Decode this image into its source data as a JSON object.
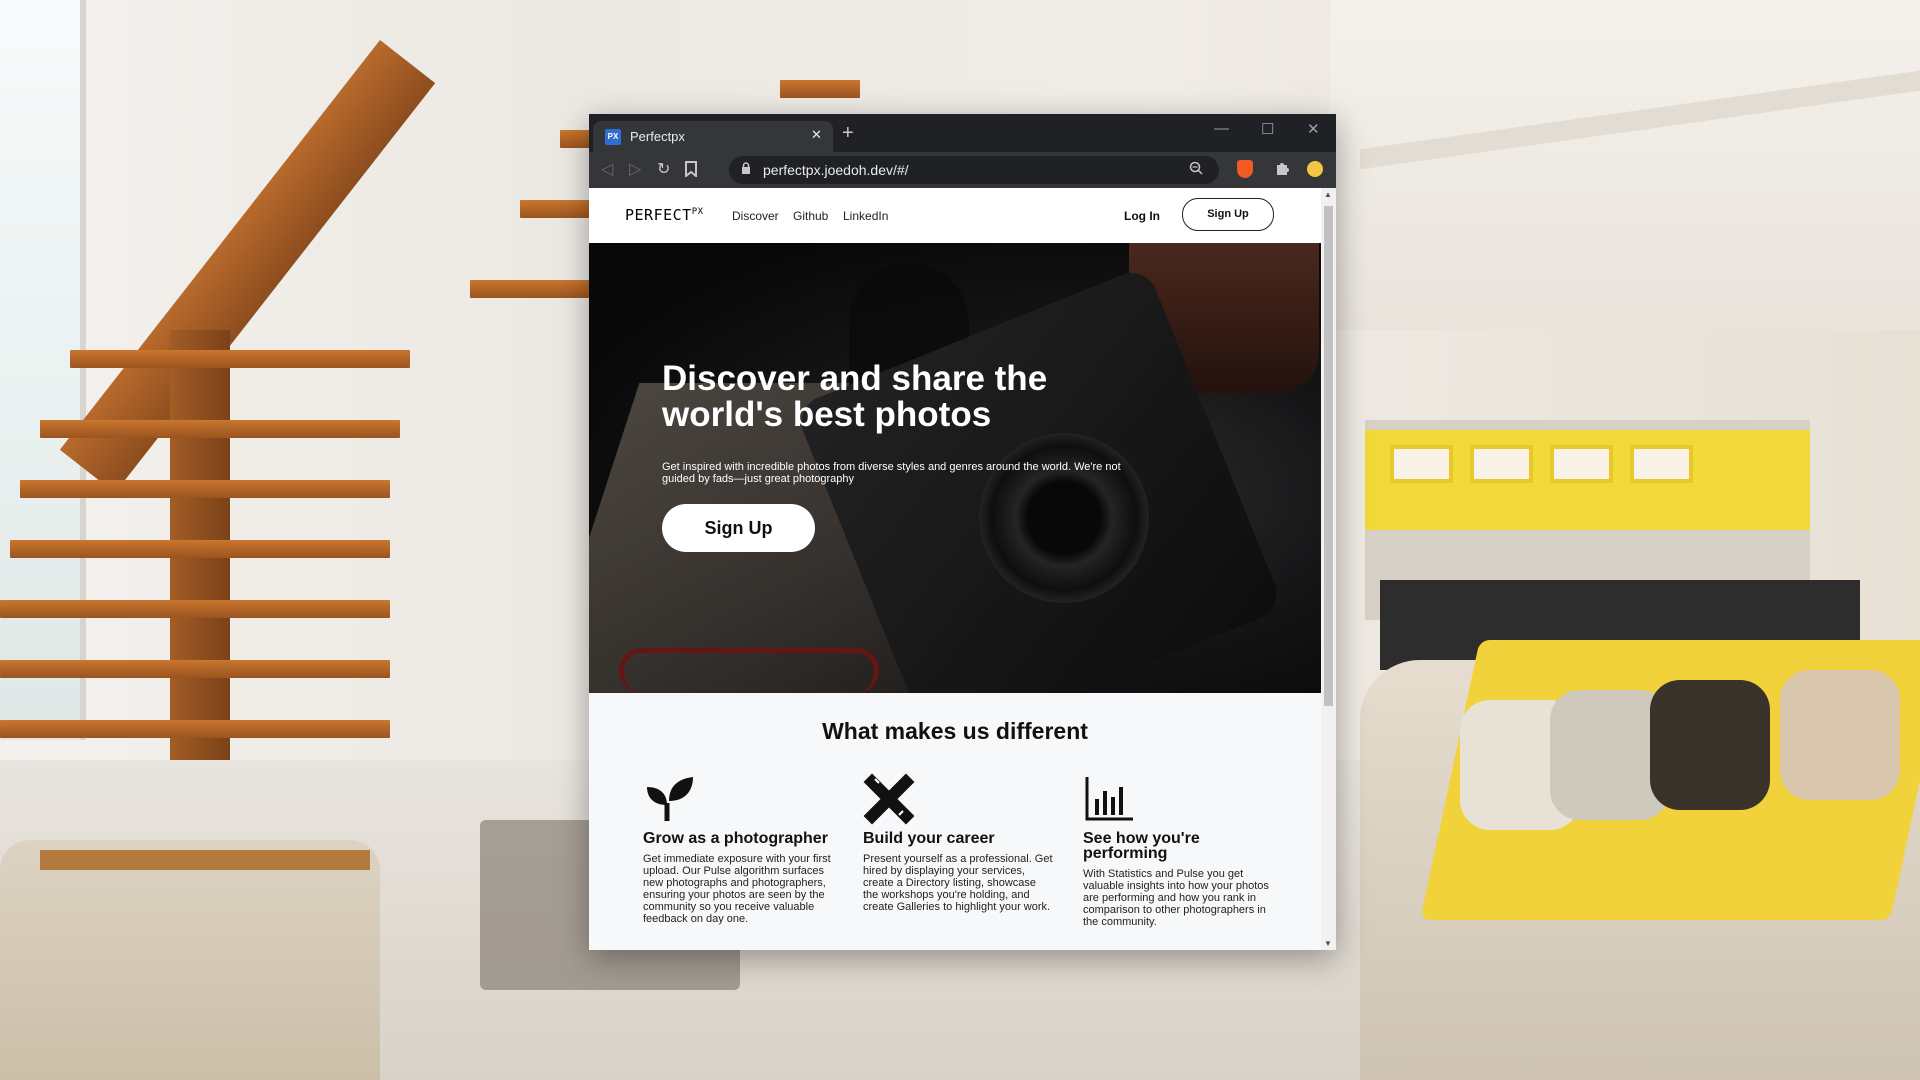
{
  "browser": {
    "tab_title": "Perfectpx",
    "tab_favicon_text": "PX",
    "url": "perfectpx.joedoh.dev/#/",
    "newtab_icon": "+",
    "close_icon": "✕",
    "minimize_icon": "—",
    "maximize_icon": "☐",
    "window_close_icon": "✕"
  },
  "site": {
    "logo_text": "PERFECT",
    "logo_sup": "PX",
    "nav": [
      "Discover",
      "Github",
      "LinkedIn"
    ],
    "login": "Log In",
    "signup_small": "Sign Up"
  },
  "hero": {
    "title": "Discover and share the world's best photos",
    "subtitle": "Get inspired with incredible photos from diverse styles and genres around the world. We're not guided by fads—just great photography",
    "cta": "Sign Up"
  },
  "different": {
    "title": "What makes us different",
    "features": [
      {
        "icon": "sprout-icon",
        "title": "Grow as a photographer",
        "desc": "Get immediate exposure with your first upload. Our Pulse algorithm surfaces new photographs and photographers, ensuring your photos are seen by the community so you receive valuable feedback on day one."
      },
      {
        "icon": "pencil-ruler-icon",
        "title": "Build your career",
        "desc": "Present yourself as a professional. Get hired by displaying your services, create a Directory listing, showcase the workshops you're holding, and create Galleries to highlight your work."
      },
      {
        "icon": "bar-chart-icon",
        "title": "See how you're performing",
        "desc": "With Statistics and Pulse you get valuable insights into how your photos are performing and how you rank in comparison to other photographers in the community."
      }
    ]
  },
  "colors": {
    "browser_frame": "#202124",
    "toolbar": "#35363a",
    "page_bg": "#f7f8fa",
    "favicon_blue": "#2f6fd1",
    "brave_orange": "#f15a22"
  }
}
